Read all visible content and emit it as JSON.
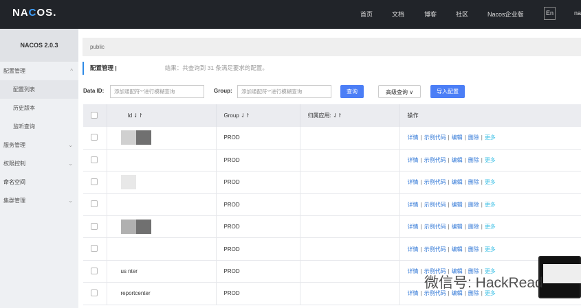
{
  "header": {
    "logo": "NACOS.",
    "nav": [
      "首页",
      "文档",
      "博客",
      "社区",
      "Nacos企业版"
    ],
    "lang": "En",
    "user": "na"
  },
  "sidebar": {
    "version": "NACOS 2.0.3",
    "items": [
      {
        "label": "配置管理",
        "expanded": true
      },
      {
        "label": "配置列表",
        "sub": true,
        "selected": true
      },
      {
        "label": "历史版本",
        "sub": true
      },
      {
        "label": "监听查询",
        "sub": true
      },
      {
        "label": "服务管理"
      },
      {
        "label": "权限控制"
      },
      {
        "label": "命名空间"
      },
      {
        "label": "集群管理"
      }
    ]
  },
  "breadcrumb": "public",
  "title": "配置管理 |",
  "result": "结果：共查询到 31 条满足要求的配置。",
  "search": {
    "dataid_label": "Data ID:",
    "dataid_placeholder": "添加通配符'*'进行模糊查询",
    "group_label": "Group:",
    "group_placeholder": "添加通配符'*'进行模糊查询",
    "query": "查询",
    "advanced": "高级查询",
    "import": "导入配置"
  },
  "table": {
    "headers": [
      "Id",
      "Group",
      "归属应用:",
      "操作"
    ],
    "rows": [
      {
        "id": "",
        "group": "PROD"
      },
      {
        "id": "",
        "group": "PROD"
      },
      {
        "id": "",
        "group": "PROD"
      },
      {
        "id": "",
        "group": "PROD"
      },
      {
        "id": "",
        "group": "PROD"
      },
      {
        "id": "",
        "group": "PROD"
      },
      {
        "id": "us    nter",
        "group": "PROD"
      },
      {
        "id": "reportcenter",
        "group": "PROD"
      }
    ],
    "ops": [
      "详情",
      "示例代码",
      "编辑",
      "删除",
      "更多"
    ]
  },
  "watermark": "微信号: HackRead",
  "colors": {
    "header": "#212429",
    "primary": "#4b7ef6",
    "link": "#2e76d6"
  }
}
